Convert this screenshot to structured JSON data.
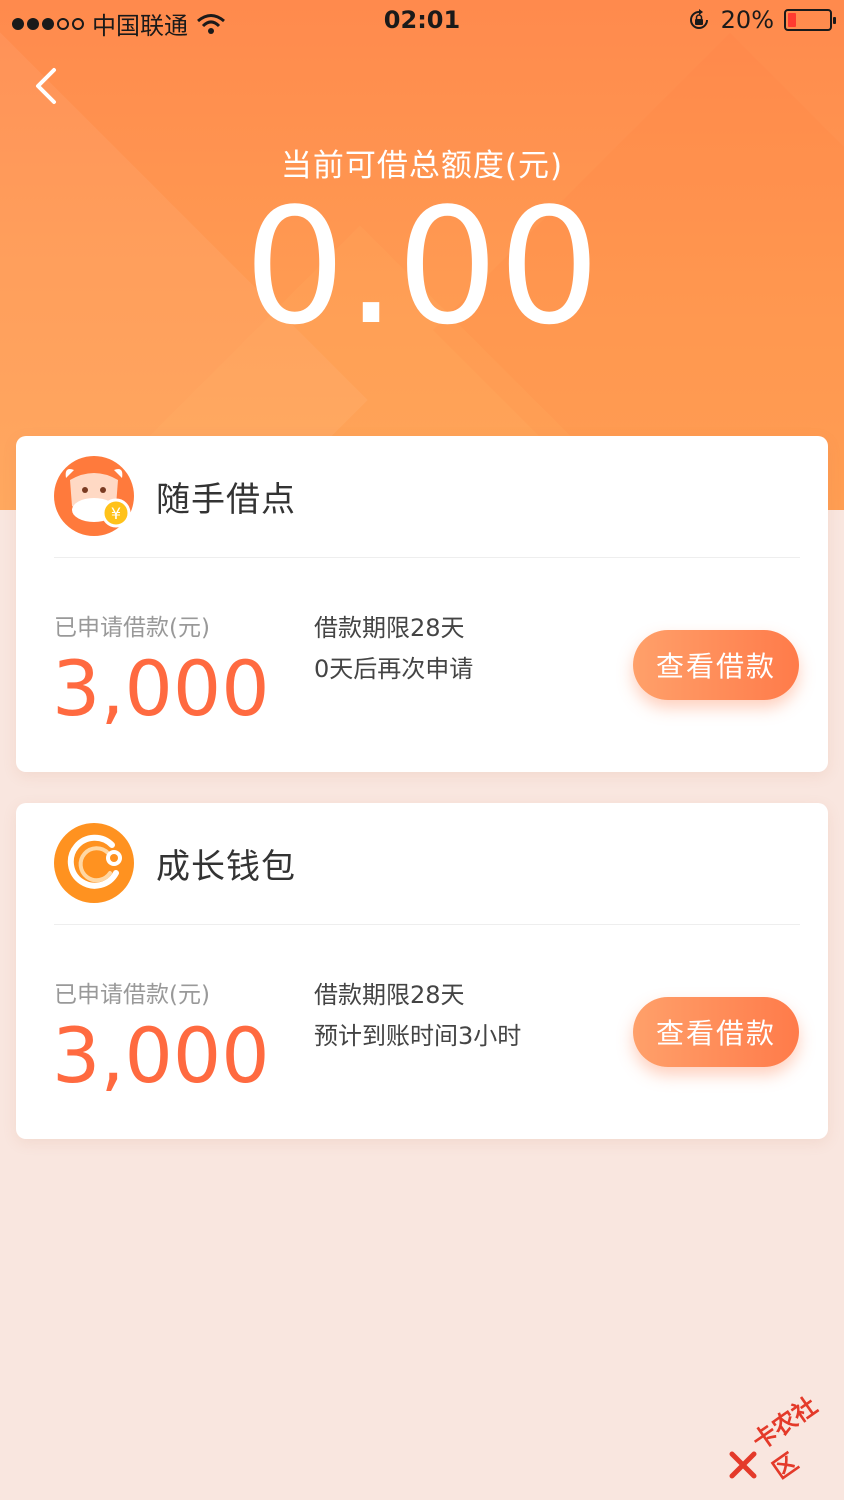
{
  "status_bar": {
    "carrier": "中国联通",
    "time": "02:01",
    "battery_percent": "20%",
    "battery_level": 0.2
  },
  "header": {
    "label": "当前可借总额度(元)",
    "amount": "0.00"
  },
  "products": [
    {
      "name": "随手借点",
      "logo_icon": "cow-with-coin-icon",
      "applied_label": "已申请借款(元)",
      "applied_amount": "3,000",
      "term": "借款期限28天",
      "note": "0天后再次申请",
      "button_label": "查看借款"
    },
    {
      "name": "成长钱包",
      "logo_icon": "orange-circle-swirl-icon",
      "applied_label": "已申请借款(元)",
      "applied_amount": "3,000",
      "term": "借款期限28天",
      "note": "预计到账时间3小时",
      "button_label": "查看借款"
    }
  ],
  "watermark": "卡农社区",
  "colors": {
    "accent": "#ff7b4a",
    "amount": "#ff6a40",
    "background": "#f9e6df"
  }
}
